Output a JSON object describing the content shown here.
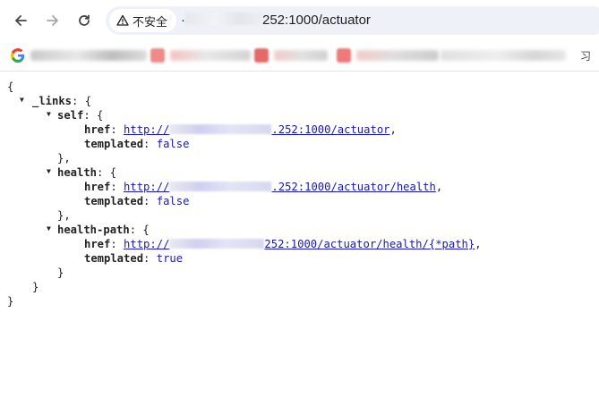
{
  "browser": {
    "security_label": "不安全",
    "address_host_masked": "·",
    "address_rest": "252:1000/actuator",
    "bookmarks_overflow": "习"
  },
  "json_view": {
    "open_brace": "{",
    "close_brace": "}",
    "links_key": "_links",
    "self_key": "self",
    "health_key": "health",
    "health_path_key": "health-path",
    "href_key": "href",
    "templated_key": "templated",
    "self_href_prefix": "http://",
    "self_href_suffix": ".252:1000/actuator",
    "self_templated": "false",
    "health_href_prefix": "http://",
    "health_href_suffix": ".252:1000/actuator/health",
    "health_templated": "false",
    "health_path_href_prefix": "http://",
    "health_path_href_suffix": "252:1000/actuator/health/{*path}",
    "health_path_templated": "true"
  }
}
